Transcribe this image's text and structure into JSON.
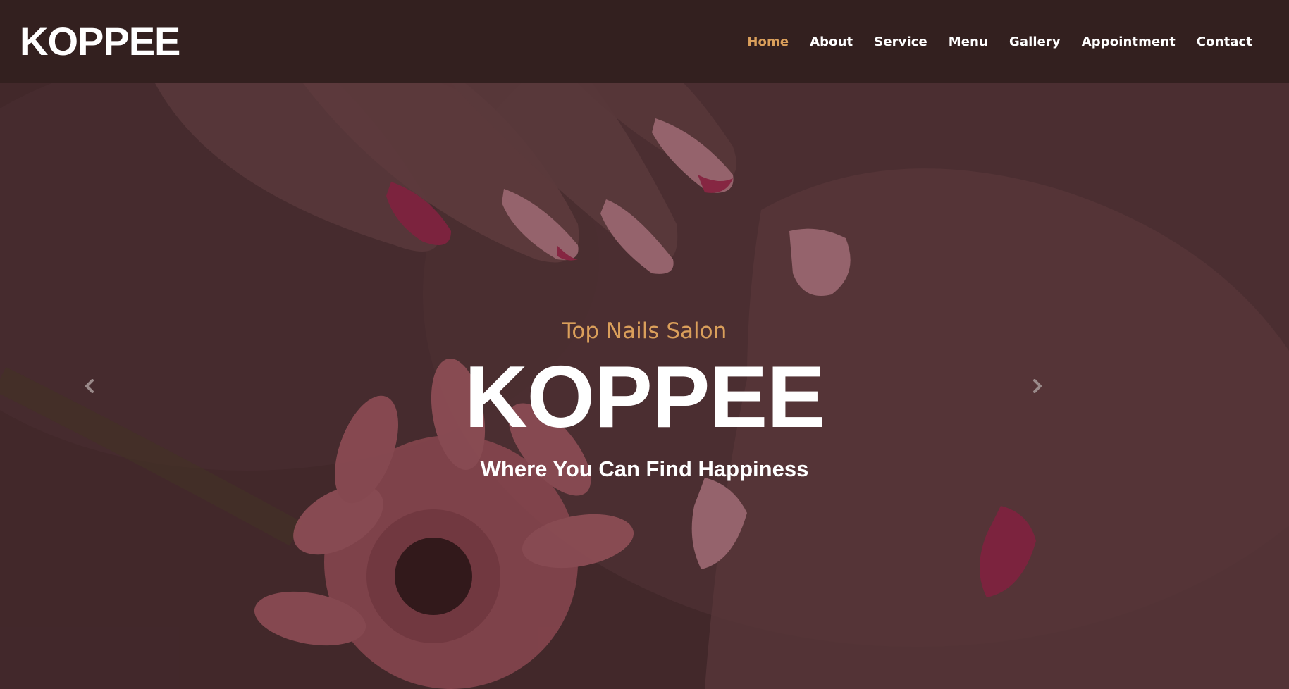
{
  "brand": {
    "name": "KOPPEE"
  },
  "nav": {
    "items": [
      {
        "label": "Home",
        "active": true
      },
      {
        "label": "About",
        "active": false
      },
      {
        "label": "Service",
        "active": false
      },
      {
        "label": "Menu",
        "active": false
      },
      {
        "label": "Gallery",
        "active": false
      },
      {
        "label": "Appointment",
        "active": false
      },
      {
        "label": "Contact",
        "active": false
      }
    ]
  },
  "hero": {
    "subtitle": "Top Nails Salon",
    "headline": "KOPPEE",
    "tagline": "Where You Can Find Happiness",
    "background_image": "manicured-hands-with-pink-flower"
  },
  "carousel": {
    "prev_icon": "chevron-left-icon",
    "next_icon": "chevron-right-icon"
  },
  "colors": {
    "header_bg": "#33201f",
    "accent": "#da9f5b",
    "text": "#ffffff"
  }
}
